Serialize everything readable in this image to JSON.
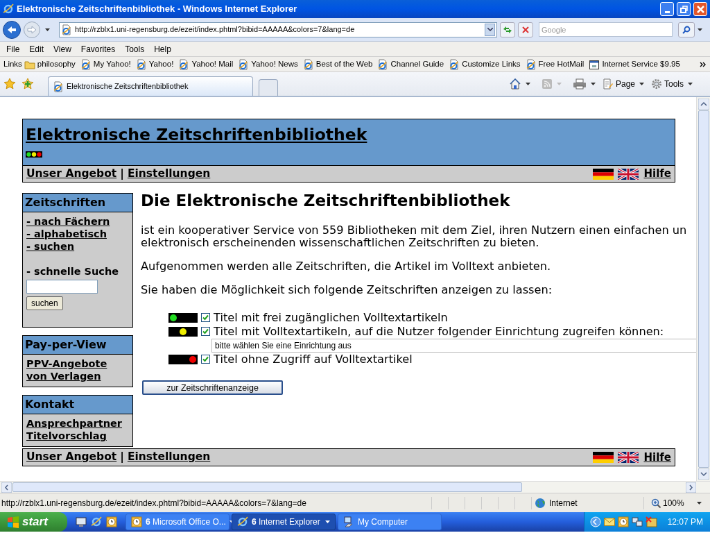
{
  "window": {
    "title": "Elektronische Zeitschriftenbibliothek - Windows Internet Explorer"
  },
  "address_bar": {
    "url": "http://rzblx1.uni-regensburg.de/ezeit/index.phtml?bibid=AAAAA&colors=7&lang=de"
  },
  "search": {
    "placeholder": "Google"
  },
  "menu": [
    "File",
    "Edit",
    "View",
    "Favorites",
    "Tools",
    "Help"
  ],
  "links_bar": {
    "label": "Links",
    "items": [
      {
        "label": "philosophy",
        "kind": "folder"
      },
      {
        "label": "My Yahoo!",
        "kind": "page"
      },
      {
        "label": "Yahoo!",
        "kind": "page"
      },
      {
        "label": "Yahoo! Mail",
        "kind": "page"
      },
      {
        "label": "Yahoo! News",
        "kind": "page"
      },
      {
        "label": "Best of the Web",
        "kind": "page"
      },
      {
        "label": "Channel Guide",
        "kind": "page"
      },
      {
        "label": "Customize Links",
        "kind": "page"
      },
      {
        "label": "Free HotMail",
        "kind": "page"
      },
      {
        "label": "Internet Service $9.95",
        "kind": "app"
      }
    ]
  },
  "tabs": [
    {
      "label": "Elektronische Zeitschriftenbibliothek",
      "selected": true
    }
  ],
  "command_bar": [
    "Page",
    "Tools"
  ],
  "page": {
    "header": {
      "title": "Elektronische Zeitschriftenbibliothek",
      "nav": [
        "Unser Angebot",
        "Einstellungen"
      ],
      "separator": "|",
      "help": "Hilfe"
    },
    "sidebar": [
      {
        "title": "Zeitschriften",
        "links": [
          "- nach Fächern",
          "- alphabetisch",
          "- suchen"
        ],
        "quick_search": {
          "label": "- schnelle Suche",
          "button": "suchen"
        }
      },
      {
        "title": "Pay-per-View",
        "links": [
          "PPV-Angebote von Verlagen"
        ]
      },
      {
        "title": "Kontakt",
        "links": [
          "Ansprechpartner",
          "Titelvorschlag"
        ]
      }
    ],
    "main": {
      "heading": "Die Elektronische Zeitschriftenbibliothek",
      "paragraphs": [
        [
          "ist ein kooperativer Service von 559 Bibliotheken mit dem Ziel, ihren Nutzern einen einfachen un",
          "elektronisch erscheinenden wissenschaftlichen Zeitschriften zu bieten."
        ],
        [
          "Aufgenommen werden alle Zeitschriften, die Artikel im Volltext anbieten."
        ],
        [
          "Sie haben die Möglichkeit sich folgende Zeitschriften anzeigen zu lassen:"
        ]
      ],
      "options": [
        {
          "kind": "green",
          "label": "Titel mit frei zugänglichen Volltextartikeln",
          "checked": true
        },
        {
          "kind": "yellow",
          "label": "Titel mit Volltextartikeln, auf die Nutzer folgender Einrichtung zugreifen können:",
          "checked": true,
          "select": "bitte wählen Sie eine Einrichtung aus"
        },
        {
          "kind": "red",
          "label": "Titel ohne Zugriff auf Volltextartikel",
          "checked": true
        }
      ],
      "button": "zur Zeitschriftenanzeige"
    },
    "footer": {
      "nav": [
        "Unser Angebot",
        "Einstellungen"
      ],
      "separator": "|",
      "help": "Hilfe"
    }
  },
  "status_bar": {
    "url": "http://rzblx1.uni-regensburg.de/ezeit/index.phtml?bibid=AAAAA&colors=7&lang=de",
    "zone": "Internet",
    "zoom": "100%"
  },
  "taskbar": {
    "start": "start",
    "tasks": [
      {
        "label": "**6** Microsoft Office O...",
        "kind": "clock",
        "selected": false
      },
      {
        "label": "**6** Internet Explorer",
        "kind": "browser",
        "selected": true
      },
      {
        "label": "My Computer",
        "kind": "computer",
        "selected": false
      }
    ],
    "clock": "12:07 PM"
  }
}
